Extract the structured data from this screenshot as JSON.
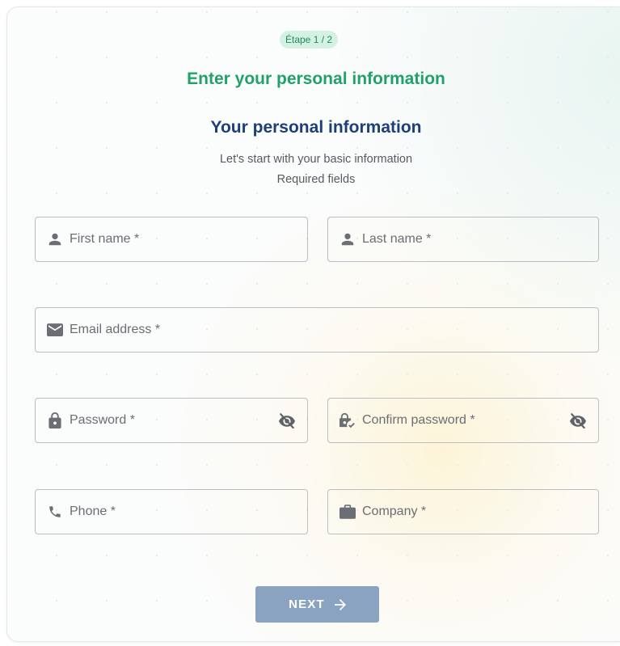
{
  "step_badge": "Étape 1 / 2",
  "header_title": "Enter your personal information",
  "section_title": "Your personal information",
  "subtitle": "Let's start with your basic information",
  "required_note": "Required fields",
  "fields": {
    "first_name": {
      "label": "First name *",
      "icon": "person-icon"
    },
    "last_name": {
      "label": "Last name *",
      "icon": "person-icon"
    },
    "email": {
      "label": "Email address *",
      "icon": "envelope-icon"
    },
    "password": {
      "label": "Password *",
      "icon": "lock-icon",
      "toggle_icon": "eye-off-icon"
    },
    "confirm_password": {
      "label": "Confirm password *",
      "icon": "lock-check-icon",
      "toggle_icon": "eye-off-icon"
    },
    "phone": {
      "label": "Phone *",
      "icon": "phone-icon"
    },
    "company": {
      "label": "Company *",
      "icon": "briefcase-icon"
    }
  },
  "next_button": {
    "label": "NEXT",
    "icon": "arrow-right-icon"
  },
  "colors": {
    "accent_green": "#21a16a",
    "title_blue": "#1d3f78",
    "badge_bg": "#d5f1e4",
    "button_bg": "#8aa3c0",
    "field_border": "#b9bec4"
  }
}
